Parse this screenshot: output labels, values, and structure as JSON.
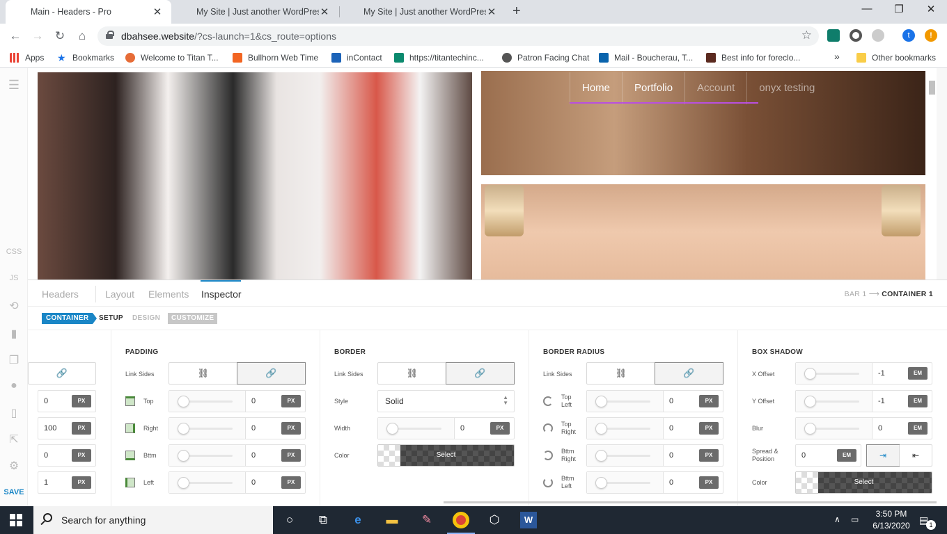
{
  "browser": {
    "tabs": [
      {
        "title": "Main - Headers - Pro",
        "active": true
      },
      {
        "title": "My Site | Just another WordPress",
        "active": false
      },
      {
        "title": "My Site | Just another WordPress",
        "active": false
      }
    ],
    "url_host": "dbahsee.website",
    "url_path": "/?cs-launch=1&cs_route=options",
    "profile_initial": "t",
    "notification_badge": "!"
  },
  "bookmarks": {
    "items": [
      {
        "label": "Apps",
        "icon": "apps-grid-icon",
        "color": "#ea4335"
      },
      {
        "label": "Bookmarks",
        "icon": "star-icon",
        "color": "#1a73e8"
      },
      {
        "label": "Welcome to Titan T...",
        "icon": "titan-icon",
        "color": "#e66c37"
      },
      {
        "label": "Bullhorn Web Time",
        "icon": "bullhorn-icon",
        "color": "#f26522"
      },
      {
        "label": "inContact",
        "icon": "incontact-icon",
        "color": "#1c63b8"
      },
      {
        "label": "https://titantechinc...",
        "icon": "sharepoint-icon",
        "color": "#0b8a6e"
      },
      {
        "label": "Patron Facing Chat",
        "icon": "chat-icon",
        "color": "#555555"
      },
      {
        "label": "Mail - Boucherau, T...",
        "icon": "outlook-icon",
        "color": "#0a64ad"
      },
      {
        "label": "Best info for foreclo...",
        "icon": "foreclosure-icon",
        "color": "#5b2a1f"
      }
    ],
    "overflow": "»",
    "other": "Other bookmarks"
  },
  "left_sidebar": {
    "css": "CSS",
    "js": "JS",
    "save": "SAVE"
  },
  "site_nav": {
    "items": [
      "Home",
      "Portfolio",
      "Account",
      "onyx testing"
    ]
  },
  "builder": {
    "tabs": [
      "Headers",
      "Layout",
      "Elements",
      "Inspector"
    ],
    "active_tab": "Inspector",
    "breadcrumb_parent": "BAR 1",
    "breadcrumb_arrow": "⟶",
    "breadcrumb_current": "CONTAINER 1",
    "subtabs": {
      "container": "CONTAINER",
      "setup": "SETUP",
      "design": "DESIGN",
      "customize": "CUSTOMIZE"
    },
    "partial_column": {
      "rows": [
        {
          "value": "0",
          "unit": "PX"
        },
        {
          "value": "100",
          "unit": "PX"
        },
        {
          "value": "0",
          "unit": "PX"
        },
        {
          "value": "1",
          "unit": "PX"
        }
      ]
    },
    "padding": {
      "heading": "PADDING",
      "link_sides_label": "Link Sides",
      "rows": [
        {
          "label": "Top",
          "value": "0",
          "unit": "PX"
        },
        {
          "label": "Right",
          "value": "0",
          "unit": "PX"
        },
        {
          "label": "Bttm",
          "value": "0",
          "unit": "PX"
        },
        {
          "label": "Left",
          "value": "0",
          "unit": "PX"
        }
      ]
    },
    "border": {
      "heading": "BORDER",
      "link_sides_label": "Link Sides",
      "style_label": "Style",
      "style_value": "Solid",
      "width_label": "Width",
      "width_value": "0",
      "width_unit": "PX",
      "color_label": "Color",
      "color_button": "Select"
    },
    "border_radius": {
      "heading": "BORDER RADIUS",
      "link_sides_label": "Link Sides",
      "rows": [
        {
          "label": "Top Left",
          "value": "0",
          "unit": "PX"
        },
        {
          "label": "Top Right",
          "value": "0",
          "unit": "PX"
        },
        {
          "label": "Bttm Right",
          "value": "0",
          "unit": "PX"
        },
        {
          "label": "Bttm Left",
          "value": "0",
          "unit": "PX"
        }
      ]
    },
    "box_shadow": {
      "heading": "BOX SHADOW",
      "rows": [
        {
          "label": "X Offset",
          "value": "-1",
          "unit": "EM"
        },
        {
          "label": "Y Offset",
          "value": "-1",
          "unit": "EM"
        },
        {
          "label": "Blur",
          "value": "0",
          "unit": "EM"
        }
      ],
      "spread_label": "Spread & Position",
      "spread_value": "0",
      "spread_unit": "EM",
      "color_label": "Color",
      "color_button": "Select"
    }
  },
  "taskbar": {
    "search_placeholder": "Search for anything",
    "time": "3:50 PM",
    "date": "6/13/2020",
    "notification_count": "1"
  },
  "colors": {
    "accent": "#1a86c6",
    "nav_underline": "#b94fe0",
    "taskbar": "#1f2833"
  }
}
